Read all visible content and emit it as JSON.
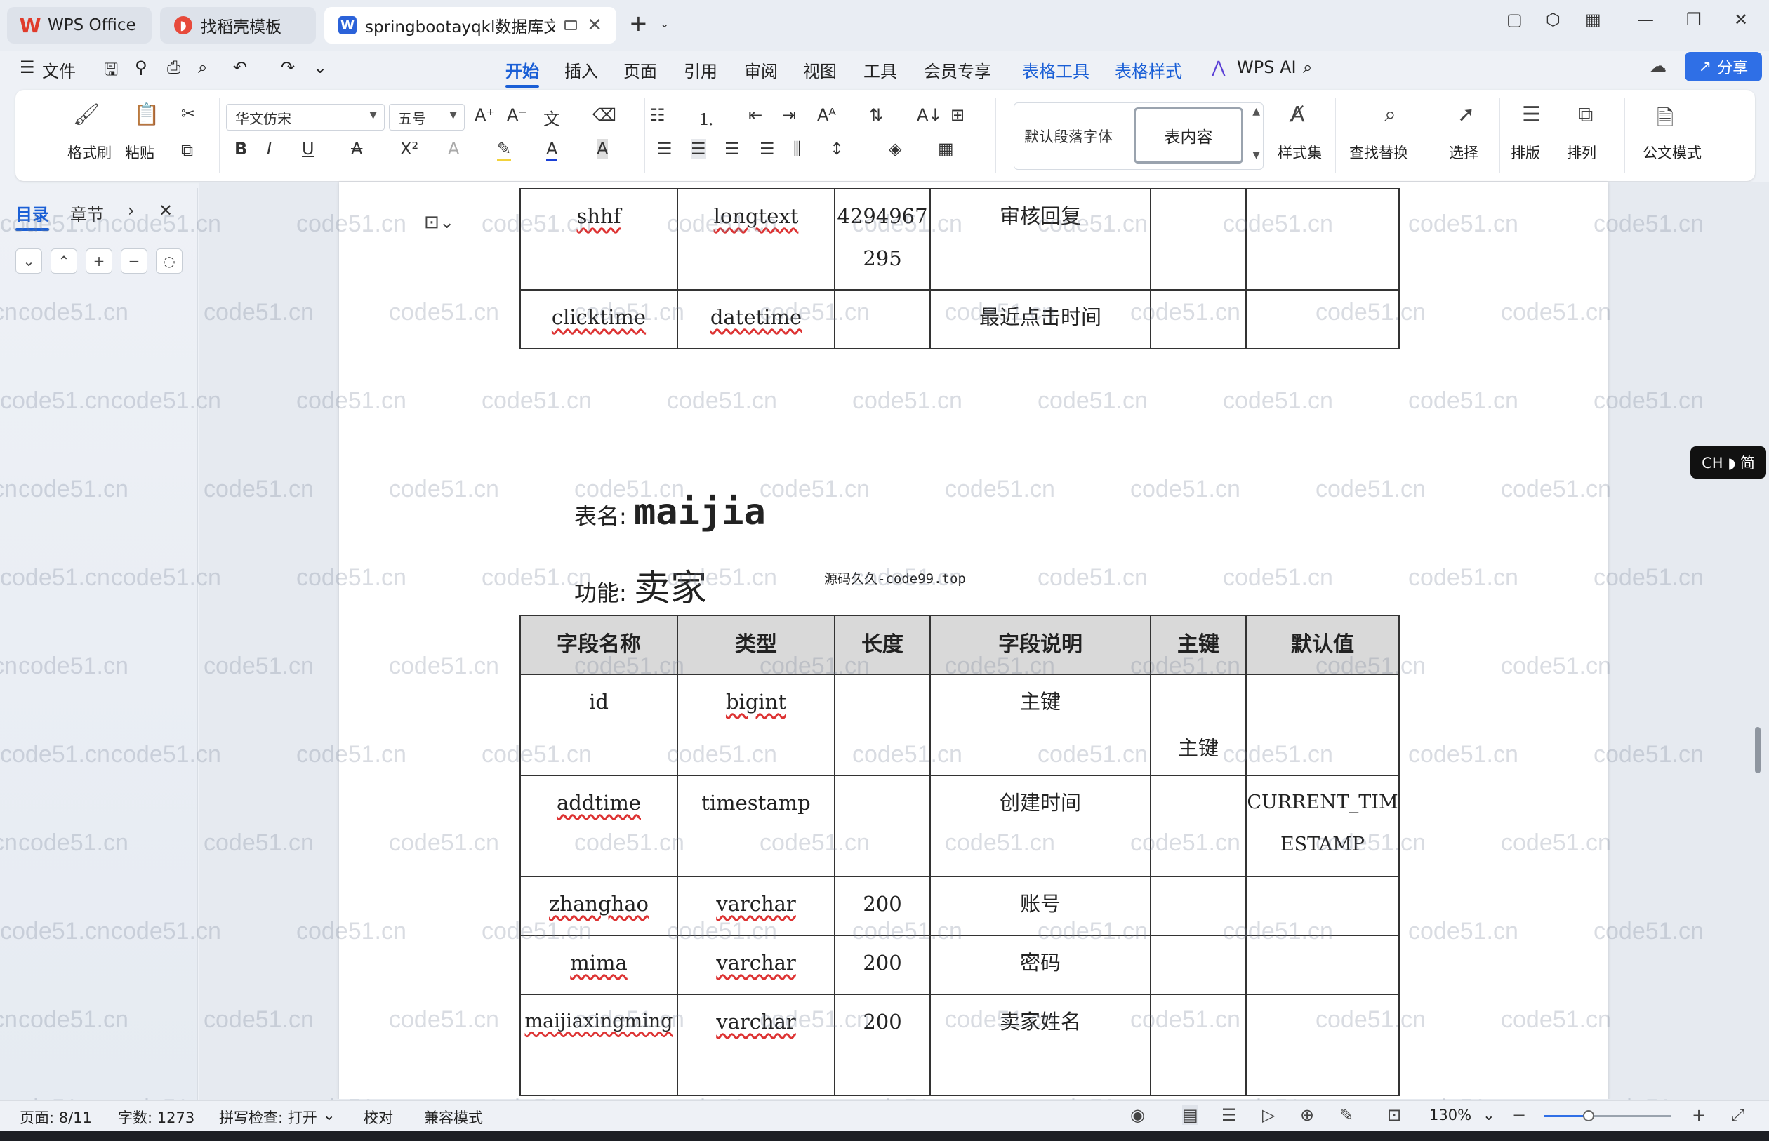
{
  "tabs": {
    "wps": "WPS Office",
    "templates": "找稻壳模板",
    "doc": "springbootayqkl数据库文档"
  },
  "menu": {
    "file": "文件",
    "items": [
      "开始",
      "插入",
      "页面",
      "引用",
      "审阅",
      "视图",
      "工具",
      "会员专享",
      "表格工具",
      "表格样式",
      "WPS AI"
    ],
    "share": "分享"
  },
  "ribbon": {
    "format_painter": "格式刷",
    "paste": "粘贴",
    "font_name": "华文仿宋",
    "font_size": "五号",
    "style_default": "默认段落字体",
    "style_selected": "表内容",
    "style_set": "样式集",
    "find_replace": "查找替换",
    "select": "选择",
    "layout": "排版",
    "arrange": "排列",
    "official_mode": "公文模式"
  },
  "nav": {
    "tab_toc": "目录",
    "tab_chapter": "章节"
  },
  "watermark": "code51.cn",
  "prev_table": {
    "rows": [
      {
        "name": "shhf",
        "type": "longtext",
        "length": "4294967295",
        "desc": "审核回复",
        "pk": "",
        "default": ""
      },
      {
        "name": "clicktime",
        "type": "datetime",
        "length": "",
        "desc": "最近点击时间",
        "pk": "",
        "default": ""
      }
    ]
  },
  "table_title": {
    "name_label": "表名:",
    "name_value": "maijia",
    "func_label": "功能:",
    "func_value": "卖家",
    "note": "源码久久-code99.top"
  },
  "main_table": {
    "headers": [
      "字段名称",
      "类型",
      "长度",
      "字段说明",
      "主键",
      "默认值"
    ],
    "rows": [
      {
        "name": "id",
        "type": "bigint",
        "length": "",
        "desc": "主键",
        "pk": "主键",
        "default": ""
      },
      {
        "name": "addtime",
        "type": "timestamp",
        "length": "",
        "desc": "创建时间",
        "pk": "",
        "default": "CURRENT_TIMESTAMP"
      },
      {
        "name": "zhanghao",
        "type": "varchar",
        "length": "200",
        "desc": "账号",
        "pk": "",
        "default": ""
      },
      {
        "name": "mima",
        "type": "varchar",
        "length": "200",
        "desc": "密码",
        "pk": "",
        "default": ""
      },
      {
        "name": "maijiaxingming",
        "type": "varchar",
        "length": "200",
        "desc": "卖家姓名",
        "pk": "",
        "default": ""
      }
    ]
  },
  "ime": "CH ◗ 简",
  "status": {
    "page": "页面: 8/11",
    "words": "字数: 1273",
    "spell": "拼写检查: 打开",
    "proof": "校对",
    "compat": "兼容模式",
    "zoom": "130%",
    "zoom_fraction": 0.35
  }
}
